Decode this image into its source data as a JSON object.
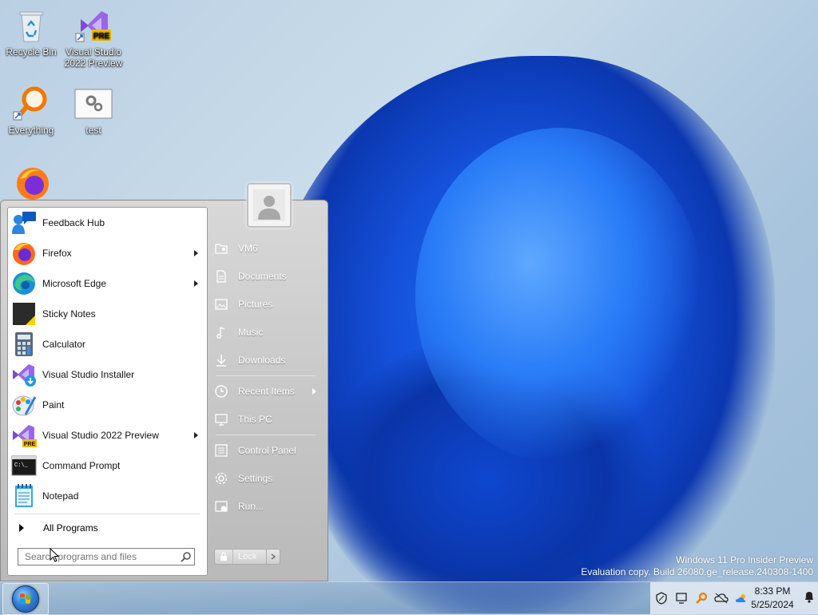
{
  "desktop": {
    "icons": [
      {
        "label": "Recycle Bin"
      },
      {
        "label": "Visual Studio 2022 Preview",
        "line1": "Visual Studio",
        "line2": "2022 Preview",
        "badge": "PRE"
      },
      {
        "label": "Everything"
      },
      {
        "label": "test"
      },
      {
        "label": "Firefox"
      }
    ],
    "watermark": {
      "line1": "Windows 11 Pro Insider Preview",
      "line2": "Evaluation copy. Build 26080.ge_release.240308-1400"
    }
  },
  "start_menu": {
    "programs": [
      {
        "label": "Feedback Hub",
        "icon": "feedback-hub-icon",
        "has_submenu": false
      },
      {
        "label": "Firefox",
        "icon": "firefox-icon",
        "has_submenu": true
      },
      {
        "label": "Microsoft Edge",
        "icon": "edge-icon",
        "has_submenu": true
      },
      {
        "label": "Sticky Notes",
        "icon": "sticky-notes-icon",
        "has_submenu": false
      },
      {
        "label": "Calculator",
        "icon": "calculator-icon",
        "has_submenu": false
      },
      {
        "label": "Visual Studio Installer",
        "icon": "vs-installer-icon",
        "has_submenu": false
      },
      {
        "label": "Paint",
        "icon": "paint-icon",
        "has_submenu": false
      },
      {
        "label": "Visual Studio 2022 Preview",
        "icon": "visual-studio-icon",
        "has_submenu": true
      },
      {
        "label": "Command Prompt",
        "icon": "command-prompt-icon",
        "has_submenu": false
      },
      {
        "label": "Notepad",
        "icon": "notepad-icon",
        "has_submenu": false
      }
    ],
    "all_programs": "All Programs",
    "search_placeholder": "Search programs and files",
    "right_items": [
      {
        "label": "VM6",
        "icon": "user-folder-icon"
      },
      {
        "label": "Documents",
        "icon": "document-icon"
      },
      {
        "label": "Pictures",
        "icon": "picture-icon"
      },
      {
        "label": "Music",
        "icon": "music-icon"
      },
      {
        "label": "Downloads",
        "icon": "download-icon"
      },
      {
        "label": "Recent Items",
        "icon": "clock-icon",
        "has_submenu": true
      },
      {
        "label": "This PC",
        "icon": "computer-icon"
      },
      {
        "label": "Control Panel",
        "icon": "control-panel-icon"
      },
      {
        "label": "Settings",
        "icon": "gear-icon"
      },
      {
        "label": "Run...",
        "icon": "run-icon"
      }
    ],
    "lock_label": "Lock"
  },
  "taskbar": {
    "time": "8:33 PM",
    "date": "5/25/2024"
  }
}
